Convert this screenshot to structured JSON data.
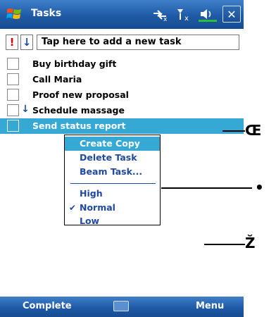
{
  "titlebar": {
    "title": "Tasks",
    "start_icon": "windows-flag-icon",
    "status_icons": [
      "connectivity-icon",
      "signal-icon",
      "volume-icon"
    ],
    "close_label": "✕"
  },
  "entry": {
    "priority_glyph": "!",
    "sort_glyph": "↓",
    "placeholder": "Tap here to add a new task"
  },
  "tasks": [
    {
      "label": "Buy birthday gift",
      "priority": "",
      "selected": false
    },
    {
      "label": "Call Maria",
      "priority": "",
      "selected": false
    },
    {
      "label": "Proof new proposal",
      "priority": "",
      "selected": false
    },
    {
      "label": "Schedule massage",
      "priority": "↓",
      "selected": false
    },
    {
      "label": "Send status report",
      "priority": "",
      "selected": true
    }
  ],
  "context_menu": {
    "items": [
      {
        "label": "Create Copy",
        "highlighted": true
      },
      {
        "label": "Delete Task",
        "highlighted": false
      },
      {
        "label": "Beam Task...",
        "highlighted": false
      },
      {
        "label": "High",
        "highlighted": false
      },
      {
        "label": "Normal",
        "highlighted": false,
        "checked": true
      },
      {
        "label": "Low",
        "highlighted": false
      }
    ],
    "check_glyph": "✔"
  },
  "bottombar": {
    "left_softkey": "Complete",
    "keyboard_icon": "keyboard-icon",
    "right_softkey": "Menu"
  },
  "callouts": [
    {
      "label": "Œ"
    },
    {
      "label": "•"
    },
    {
      "label": "Ž"
    }
  ],
  "colors": {
    "bar_blue": "#1f5aa6",
    "selection": "#35a8d4",
    "menu_text": "#1f4aa0",
    "priority_red": "#d40000"
  }
}
